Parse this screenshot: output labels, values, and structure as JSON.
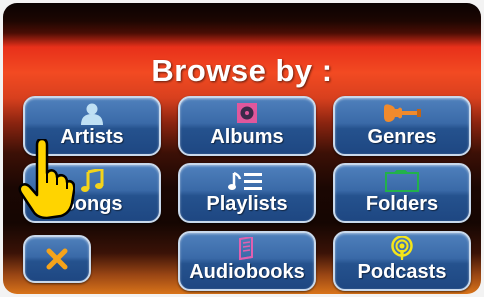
{
  "header": {
    "title": "Browse by :"
  },
  "buttons": [
    {
      "key": "artists",
      "label": "Artists",
      "icon": "person-icon"
    },
    {
      "key": "albums",
      "label": "Albums",
      "icon": "album-icon"
    },
    {
      "key": "genres",
      "label": "Genres",
      "icon": "guitar-icon"
    },
    {
      "key": "songs",
      "label": "Songs",
      "icon": "music-note-icon"
    },
    {
      "key": "playlists",
      "label": "Playlists",
      "icon": "playlist-icon"
    },
    {
      "key": "folders",
      "label": "Folders",
      "icon": "folder-icon"
    },
    {
      "key": "audiobooks",
      "label": "Audiobooks",
      "icon": "book-icon"
    },
    {
      "key": "podcasts",
      "label": "Podcasts",
      "icon": "podcast-icon"
    }
  ],
  "close": {
    "icon": "close-icon"
  },
  "pointer": {
    "icon": "hand-pointer-icon"
  },
  "colors": {
    "button_blue": "#3a6aa8",
    "button_border": "#c9d9ec",
    "close_x": "#f5a31a",
    "albums_icon": "#e0579c",
    "genres_icon": "#f08a2c",
    "songs_icon": "#f4d41a",
    "folders_icon": "#22b14c",
    "podcasts_icon": "#f4e51a"
  }
}
